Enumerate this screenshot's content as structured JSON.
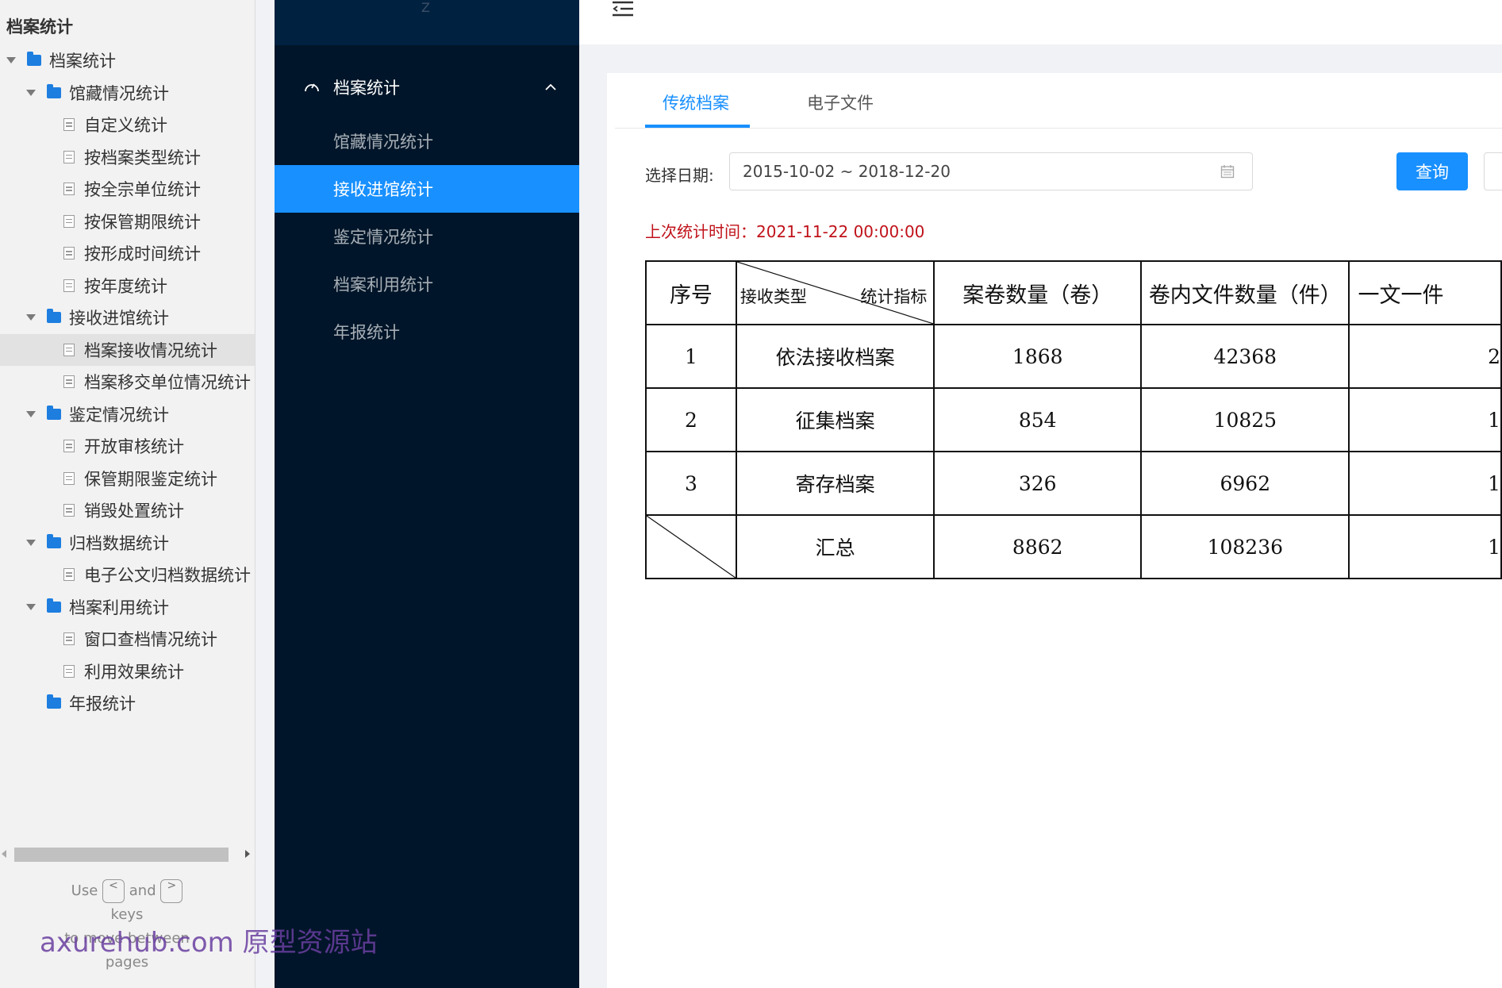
{
  "sitemap": {
    "title": "档案统计",
    "items": [
      {
        "label": "档案统计",
        "kind": "folder",
        "level": 0,
        "expanded": true
      },
      {
        "label": "馆藏情况统计",
        "kind": "folder",
        "level": 1,
        "expanded": true
      },
      {
        "label": "自定义统计",
        "kind": "page",
        "level": 2
      },
      {
        "label": "按档案类型统计",
        "kind": "page",
        "level": 2
      },
      {
        "label": "按全宗单位统计",
        "kind": "page",
        "level": 2
      },
      {
        "label": "按保管期限统计",
        "kind": "page",
        "level": 2
      },
      {
        "label": "按形成时间统计",
        "kind": "page",
        "level": 2
      },
      {
        "label": "按年度统计",
        "kind": "page",
        "level": 2
      },
      {
        "label": "接收进馆统计",
        "kind": "folder",
        "level": 1,
        "expanded": true
      },
      {
        "label": "档案接收情况统计",
        "kind": "page",
        "level": 2,
        "selected": true
      },
      {
        "label": "档案移交单位情况统计",
        "kind": "page",
        "level": 2
      },
      {
        "label": "鉴定情况统计",
        "kind": "folder",
        "level": 1,
        "expanded": true
      },
      {
        "label": "开放审核统计",
        "kind": "page",
        "level": 2
      },
      {
        "label": "保管期限鉴定统计",
        "kind": "page",
        "level": 2
      },
      {
        "label": "销毁处置统计",
        "kind": "page",
        "level": 2
      },
      {
        "label": "归档数据统计",
        "kind": "folder",
        "level": 1,
        "expanded": true
      },
      {
        "label": "电子公文归档数据统计",
        "kind": "page",
        "level": 2
      },
      {
        "label": "档案利用统计",
        "kind": "folder",
        "level": 1,
        "expanded": true
      },
      {
        "label": "窗口查档情况统计",
        "kind": "page",
        "level": 2
      },
      {
        "label": "利用效果统计",
        "kind": "page",
        "level": 2
      },
      {
        "label": "年报统计",
        "kind": "folder",
        "level": 1,
        "expanded": false
      }
    ],
    "hint": {
      "use": "Use",
      "key_left": "<",
      "and": "and",
      "key_right": ">",
      "keys": "keys",
      "move": "to move between",
      "pages": "pages"
    },
    "watermark": "axurehub.com 原型资源站"
  },
  "side_menu": {
    "logo_text": "Z",
    "group_label": "档案统计",
    "items": [
      {
        "label": "馆藏情况统计",
        "active": false
      },
      {
        "label": "接收进馆统计",
        "active": true
      },
      {
        "label": "鉴定情况统计",
        "active": false
      },
      {
        "label": "档案利用统计",
        "active": false
      },
      {
        "label": "年报统计",
        "active": false
      }
    ]
  },
  "main": {
    "tabs": [
      {
        "label": "传统档案",
        "active": true
      },
      {
        "label": "电子文件",
        "active": false
      }
    ],
    "date_label": "选择日期:",
    "date_value": "2015-10-02 ~ 2018-12-20",
    "query_label": "查询",
    "last_stat": "上次统计时间：2021-11-22 00:00:00",
    "table": {
      "headers": {
        "index": "序号",
        "diag_left": "接收类型",
        "diag_right": "统计指标",
        "volumes": "案卷数量（卷）",
        "files": "卷内文件数量（件）",
        "single": "一文一件"
      },
      "rows": [
        {
          "index": "1",
          "type": "依法接收档案",
          "volumes": "1868",
          "files": "42368",
          "single": "2"
        },
        {
          "index": "2",
          "type": "征集档案",
          "volumes": "854",
          "files": "10825",
          "single": "1"
        },
        {
          "index": "3",
          "type": "寄存档案",
          "volumes": "326",
          "files": "6962",
          "single": "1"
        }
      ],
      "total": {
        "type": "汇总",
        "volumes": "8862",
        "files": "108236",
        "single": "1"
      }
    }
  },
  "colors": {
    "accent": "#1890ff",
    "sidebar_bg": "#001529",
    "alert_text": "#c0121a",
    "folder": "#1d7ee0"
  }
}
